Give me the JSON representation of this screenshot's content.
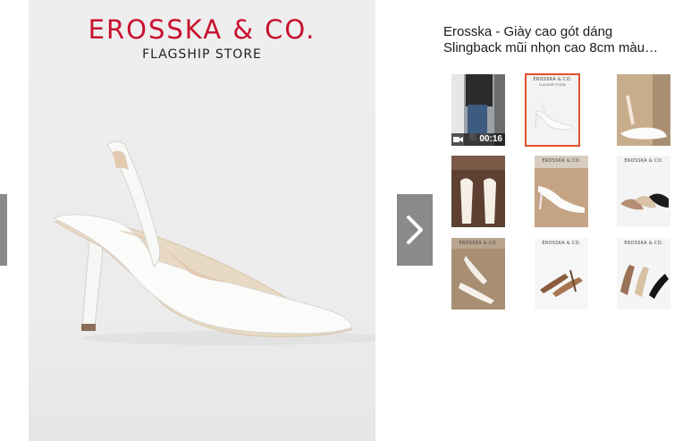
{
  "main_image": {
    "brand": "EROSSKA & CO.",
    "tagline": "FLAGSHIP STORE"
  },
  "product": {
    "title_line1": "Erosska - Giày cao gót dáng",
    "title_line2": "Slingback mũi nhọn cao 8cm màu…"
  },
  "gallery": {
    "video_duration": "00:16",
    "thumb_brand": "EROSSKA & CO.",
    "thumb_tagline": "FLAGSHIP STORE"
  },
  "colors": {
    "brand_red": "#c8102e",
    "active_outline": "#e2522d",
    "nav_button": "#8a8a8a"
  },
  "icons": [
    "chevron-left-icon",
    "chevron-right-icon",
    "video-camera-icon"
  ]
}
